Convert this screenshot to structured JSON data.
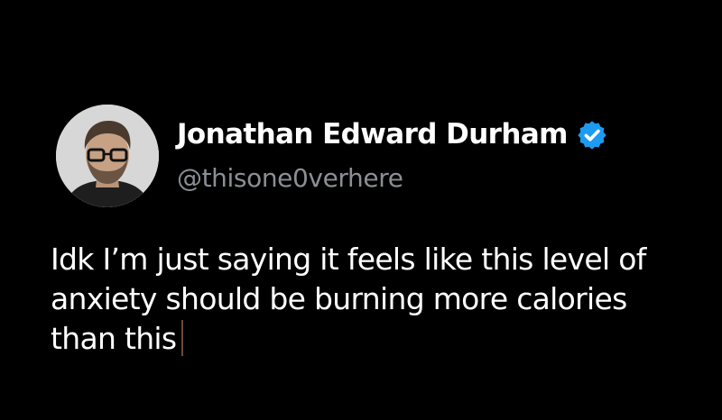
{
  "tweet": {
    "author": {
      "display_name": "Jonathan Edward Durham",
      "handle": "@thisone0verhere",
      "verified": true,
      "avatar_icon": "profile-photo"
    },
    "text_lines": [
      "Idk I’m just saying it feels like this level of",
      "anxiety should be burning more calories",
      "than this"
    ]
  },
  "colors": {
    "background": "#000000",
    "text": "#ffffff",
    "handle": "#8b8f94",
    "verified_badge": "#1d9bf0"
  }
}
